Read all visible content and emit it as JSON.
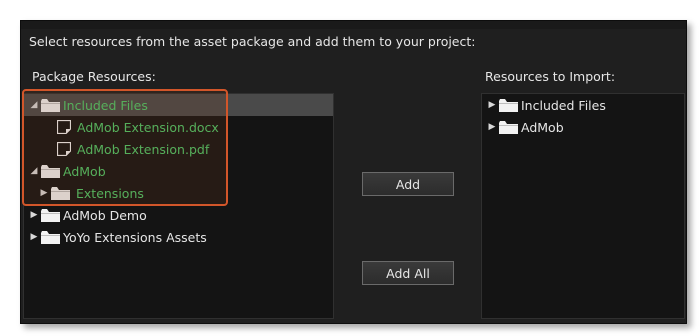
{
  "instructions": "Select resources from the asset package and add them to your project:",
  "left_panel": {
    "label": "Package Resources:",
    "items": [
      {
        "label": "Included Files",
        "type": "folder",
        "expanded": true,
        "level": 0
      },
      {
        "label": "AdMob Extension.docx",
        "type": "file",
        "level": 1
      },
      {
        "label": "AdMob Extension.pdf",
        "type": "file",
        "level": 1
      },
      {
        "label": "AdMob",
        "type": "folder",
        "expanded": true,
        "level": 0
      },
      {
        "label": "Extensions",
        "type": "folder",
        "expanded": false,
        "level": 1
      },
      {
        "label": "AdMob Demo",
        "type": "folder",
        "expanded": false,
        "level": 0
      },
      {
        "label": "YoYo Extensions Assets",
        "type": "folder",
        "expanded": false,
        "level": 0
      }
    ]
  },
  "right_panel": {
    "label": "Resources to Import:",
    "items": [
      {
        "label": "Included Files",
        "type": "folder",
        "expanded": false
      },
      {
        "label": "AdMob",
        "type": "folder",
        "expanded": false
      }
    ]
  },
  "buttons": {
    "add": "Add",
    "add_all": "Add All"
  },
  "icons": {
    "expanded": "triangle-down-icon",
    "collapsed": "triangle-right-icon",
    "folder": "folder-icon",
    "file": "document-icon"
  },
  "colors": {
    "background": "#1f1f1f",
    "pane": "#141414",
    "selected_row": "#4a4a4a",
    "highlight_text": "#4fc96a",
    "annotation_border": "#d2562a"
  }
}
